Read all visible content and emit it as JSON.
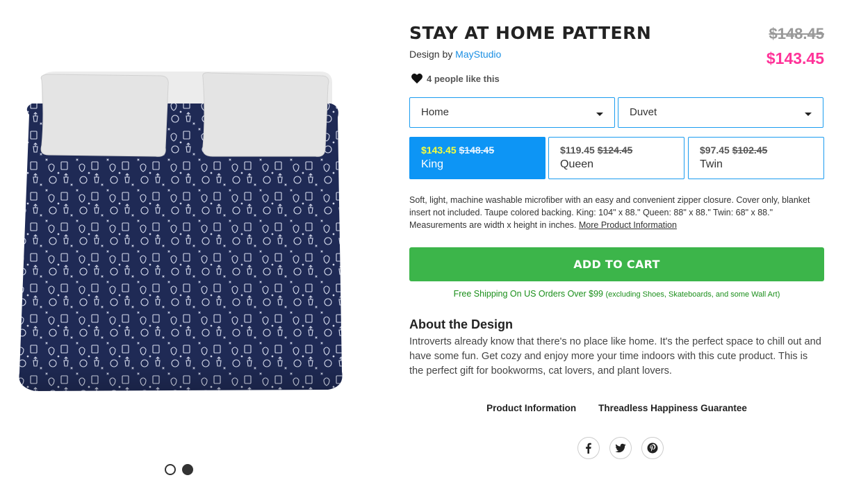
{
  "product": {
    "title": "STAY AT HOME PATTERN",
    "design_by_prefix": "Design by",
    "designer": "MayStudio",
    "old_price": "$148.45",
    "new_price": "$143.45",
    "likes": "4 people like this"
  },
  "selects": {
    "category": "Home",
    "product_type": "Duvet"
  },
  "sizes": [
    {
      "sale": "$143.45",
      "orig": "$148.45",
      "label": "King",
      "selected": true
    },
    {
      "sale": "$119.45",
      "orig": "$124.45",
      "label": "Queen",
      "selected": false
    },
    {
      "sale": "$97.45",
      "orig": "$102.45",
      "label": "Twin",
      "selected": false
    }
  ],
  "description": {
    "text": "Soft, light, machine washable microfiber with an easy and convenient zipper closure. Cover only, blanket insert not included. Taupe colored backing. King: 104\" x 88.\" Queen: 88\" x 88.\" Twin: 68\" x 88.\" Measurements are width x height in inches.",
    "more_link": "More Product Information"
  },
  "cart": {
    "label": "ADD TO CART"
  },
  "shipping": {
    "main": "Free Shipping On US Orders Over $99",
    "note": "(excluding Shoes, Skateboards, and some Wall Art)"
  },
  "about": {
    "heading": "About the Design",
    "body": "Introverts already know that there's no place like home. It's the perfect space to chill out and have some fun. Get cozy and enjoy more your time indoors with this cute product. This is the perfect gift for bookworms, cat lovers, and plant lovers."
  },
  "info_links": [
    "Product Information",
    "Threadless Happiness Guarantee"
  ],
  "social_icons": [
    "facebook-icon",
    "twitter-icon",
    "pinterest-icon"
  ],
  "colors": {
    "accent_blue": "#0d95f5",
    "sale_pink": "#ff3399",
    "cart_green": "#3cb54a",
    "duvet_navy": "#1f2a55"
  }
}
